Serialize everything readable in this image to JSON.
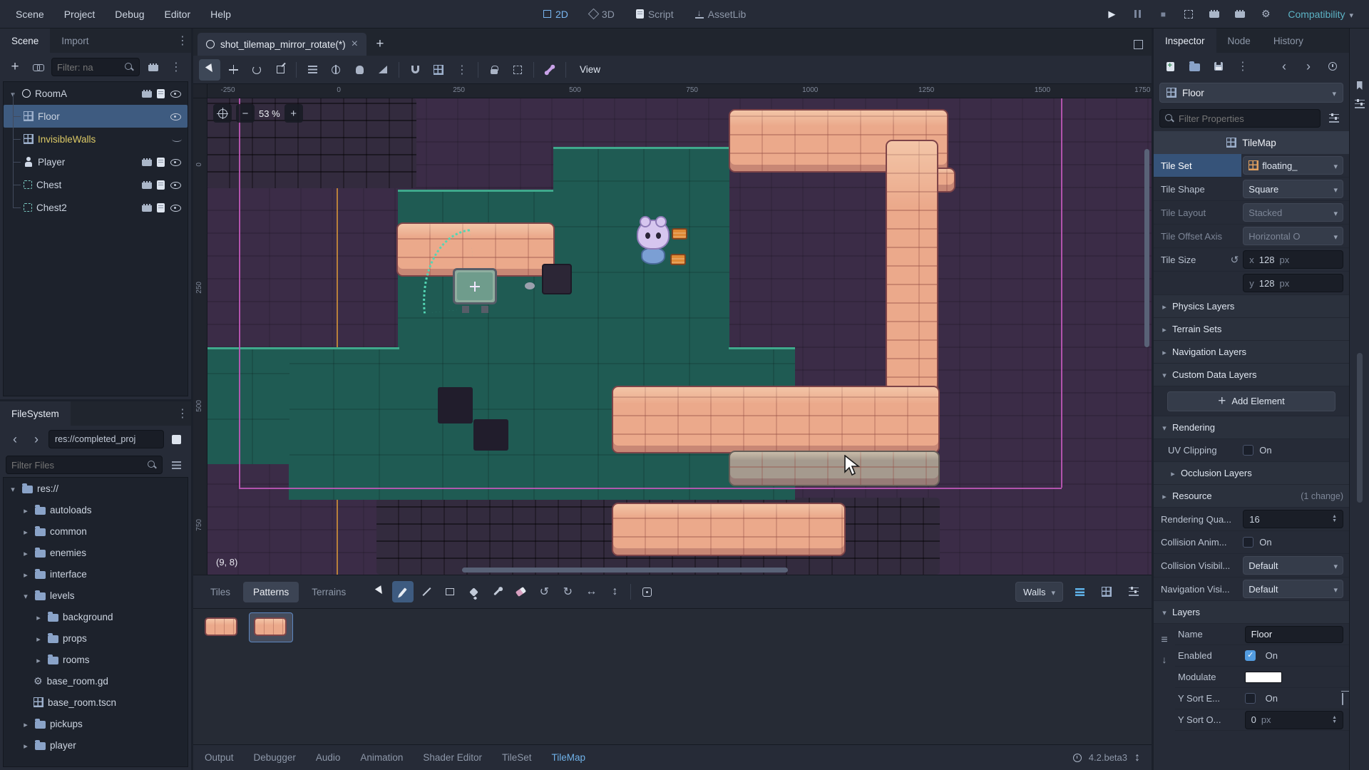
{
  "menubar": {
    "menus": [
      "Scene",
      "Project",
      "Debug",
      "Editor",
      "Help"
    ],
    "workspaces": [
      "2D",
      "3D",
      "Script",
      "AssetLib"
    ],
    "renderer": "Compatibility"
  },
  "scene_dock": {
    "tabs": [
      "Scene",
      "Import"
    ],
    "filter": "Filter: na",
    "nodes": [
      "RoomA",
      "Floor",
      "InvisibleWalls",
      "Player",
      "Chest",
      "Chest2"
    ]
  },
  "filesystem": {
    "title": "FileSystem",
    "path": "res://completed_proj",
    "filter": "Filter Files",
    "items": [
      "res://",
      "autoloads",
      "common",
      "enemies",
      "interface",
      "levels",
      "background",
      "props",
      "rooms",
      "base_room.gd",
      "base_room.tscn",
      "pickups",
      "player"
    ]
  },
  "editor": {
    "tab_title": "shot_tilemap_mirror_rotate(*)",
    "view_menu": "View",
    "zoom": "53 %",
    "coords": "(9, 8)",
    "ruler_top": [
      "-250",
      "0",
      "250",
      "500",
      "750",
      "1000",
      "1250",
      "1500",
      "1750"
    ],
    "ruler_left": [
      "0",
      "250",
      "500",
      "750"
    ]
  },
  "tilemap_panel": {
    "tabs": [
      "Tiles",
      "Patterns",
      "Terrains"
    ],
    "layer": "Walls"
  },
  "statusbar": {
    "items": [
      "Output",
      "Debugger",
      "Audio",
      "Animation",
      "Shader Editor",
      "TileSet",
      "TileMap"
    ],
    "version": "4.2.beta3"
  },
  "inspector": {
    "tabs": [
      "Inspector",
      "Node",
      "History"
    ],
    "resource": "Floor",
    "filter": "Filter Properties",
    "section": "TileMap",
    "tile_set": {
      "label": "Tile Set",
      "value": "floating_"
    },
    "tile_shape": {
      "label": "Tile Shape",
      "value": "Square"
    },
    "tile_layout": {
      "label": "Tile Layout",
      "value": "Stacked"
    },
    "tile_offset_axis": {
      "label": "Tile Offset Axis",
      "value": "Horizontal O"
    },
    "tile_size": {
      "label": "Tile Size",
      "x_label": "x",
      "y_label": "y",
      "x": "128",
      "y": "128",
      "unit": "px"
    },
    "groups": {
      "physics": "Physics Layers",
      "terrain": "Terrain Sets",
      "navigation": "Navigation Layers",
      "custom_data": "Custom Data Layers",
      "rendering": "Rendering",
      "occlusion": "Occlusion Layers",
      "resource": "Resource",
      "resource_badge": "(1 change)",
      "layers": "Layers"
    },
    "add_element": "Add Element",
    "uv_clipping": {
      "label": "UV Clipping",
      "value": "On"
    },
    "rendering_quadrant": {
      "label": "Rendering Qua...",
      "value": "16"
    },
    "collision_anim": {
      "label": "Collision Anim...",
      "value": "On"
    },
    "collision_visibility": {
      "label": "Collision Visibil...",
      "value": "Default"
    },
    "navigation_visibility": {
      "label": "Navigation Visi...",
      "value": "Default"
    },
    "layer_name": {
      "label": "Name",
      "value": "Floor"
    },
    "layer_enabled": {
      "label": "Enabled",
      "value": "On"
    },
    "layer_modulate": {
      "label": "Modulate",
      "swatch": "#ffffff"
    },
    "layer_ysort": {
      "label": "Y Sort E...",
      "value": "On"
    },
    "layer_ysort_origin": {
      "label": "Y Sort O...",
      "value": "0",
      "unit": "px"
    }
  }
}
